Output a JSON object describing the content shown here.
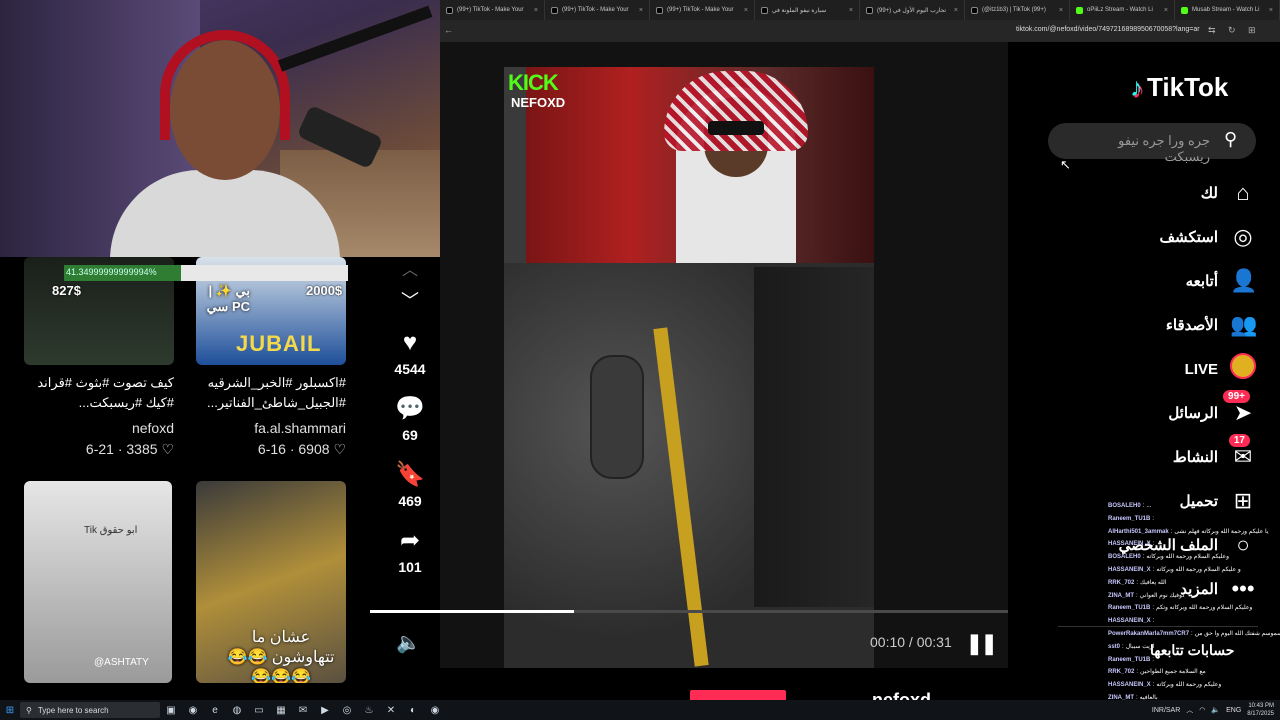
{
  "browser": {
    "tabs": [
      {
        "title": "(99+) TikTok - Make Your",
        "kind": "tiktok"
      },
      {
        "title": "(99+) TikTok - Make Your",
        "kind": "tiktok"
      },
      {
        "title": "(99+) TikTok - Make Your",
        "kind": "tiktok"
      },
      {
        "title": "سيارة نيفو الملونة في",
        "kind": "tiktok"
      },
      {
        "title": "(99+) تجارب اليوم الأول في",
        "kind": "tiktok"
      },
      {
        "title": "(@itz1b3) | TikTok (99+)",
        "kind": "tiktok"
      },
      {
        "title": "oPiiLz Stream - Watch Li",
        "kind": "kick"
      },
      {
        "title": "Musab Stream - Watch Li",
        "kind": "kick"
      }
    ],
    "url": "tiktok.com/@nefoxd/video/7497216898950670058?lang=ar"
  },
  "feed": {
    "progress_text": "41.34999999999994%",
    "progress_value": 41.35,
    "items": [
      {
        "price": "827$",
        "description": "كيف تصوت #بثوث #قراند #كيك #ريسبكت...",
        "author": "nefoxd",
        "date": "6-21",
        "likes": "3385"
      },
      {
        "price": "2000$",
        "overlay": "بي ✨ | PC سي",
        "banner": "JUBAIL",
        "description": "#اكسبلور #الخبر_الشرقيه #الجبيل_شاطئ_الفناتير...",
        "author": "fa.al.shammari",
        "date": "6-16",
        "likes": "6908"
      },
      {
        "overlay": "Tik ابو حقوق",
        "watermark": "@ASHTATY"
      },
      {
        "overlay": "عشان ما تتهاوشون 😂😂😂😂😂"
      }
    ]
  },
  "actions": {
    "likes": "4544",
    "comments": "69",
    "saves": "469",
    "shares": "101"
  },
  "video": {
    "kick_logo": "KICK",
    "kick_user": "NEFOXD",
    "time": "00:10 / 00:31",
    "progress": 0.32,
    "author": "nefoxd"
  },
  "tiktok": {
    "logo": "TikTok",
    "search_placeholder": "جره ورا جره نيفو ريسبكت",
    "nav": [
      {
        "label": "لك",
        "icon": "home-icon",
        "glyph": "⌂"
      },
      {
        "label": "استكشف",
        "icon": "compass-icon",
        "glyph": "◎"
      },
      {
        "label": "أتابعه",
        "icon": "following-icon",
        "glyph": "👤"
      },
      {
        "label": "الأصدقاء",
        "icon": "friends-icon",
        "glyph": "👥"
      },
      {
        "label": "LIVE",
        "icon": "live-icon",
        "glyph": ""
      },
      {
        "label": "الرسائل",
        "icon": "messages-icon",
        "glyph": "➤",
        "badge": "99+"
      },
      {
        "label": "النشاط",
        "icon": "activity-icon",
        "glyph": "✉",
        "badge": "17"
      },
      {
        "label": "تحميل",
        "icon": "upload-icon",
        "glyph": "⊞"
      },
      {
        "label": "الملف الشخصي",
        "icon": "profile-icon",
        "glyph": "○"
      },
      {
        "label": "المزيد",
        "icon": "more-icon",
        "glyph": "•••"
      }
    ],
    "followed_title": "حسابات تتابعها"
  },
  "chat": [
    {
      "user": "BOSALEH0",
      "text": "..."
    },
    {
      "user": "Raneem_TU1B",
      "text": ""
    },
    {
      "user": "AlHarthi501_3ammak",
      "text": "يا عليكم ورحمة الله وبركاته فهلم نشى"
    },
    {
      "user": "HASSANEIN_X",
      "text": ""
    },
    {
      "user": "BOSALEH0",
      "text": "وعليكم السلام ورحمة الله وبركاته"
    },
    {
      "user": "HASSANEIN_X",
      "text": "و عليكم السلام ورحمة الله وبركاته"
    },
    {
      "user": "RRK_702",
      "text": "الله يعافيك"
    },
    {
      "user": "ZINA_MT",
      "text": "كوفيك نوم العواني"
    },
    {
      "user": "Raneem_TU1B",
      "text": "وعليكم السلام ورحمة الله وبركاته وتكم"
    },
    {
      "user": "HASSANEIN_X",
      "text": ""
    },
    {
      "user": "PowerRakanMarla7mm7CR7",
      "text": "سموسم شفتك الله اليوم وا حق من"
    },
    {
      "user": "sst0",
      "text": "اريت سيبال"
    },
    {
      "user": "Raneem_TU1B",
      "text": ""
    },
    {
      "user": "RRK_702",
      "text": "مع السلامة جميع الطواحين"
    },
    {
      "user": "HASSANEIN_X",
      "text": "وعليكم ورحمة الله وبركاته"
    },
    {
      "user": "ZINA_MT",
      "text": "بالعافيه"
    },
    {
      "user": "Raneem_TU1B",
      "text": ""
    }
  ],
  "taskbar": {
    "search_placeholder": "Type here to search",
    "lang": "INR/SAR",
    "input": "ENG",
    "time": "10:43 PM",
    "date": "8/17/2025"
  },
  "colors": {
    "accent": "#fe2c55",
    "kick_green": "#53fc18",
    "tiktok_cyan": "#25f4ee"
  }
}
